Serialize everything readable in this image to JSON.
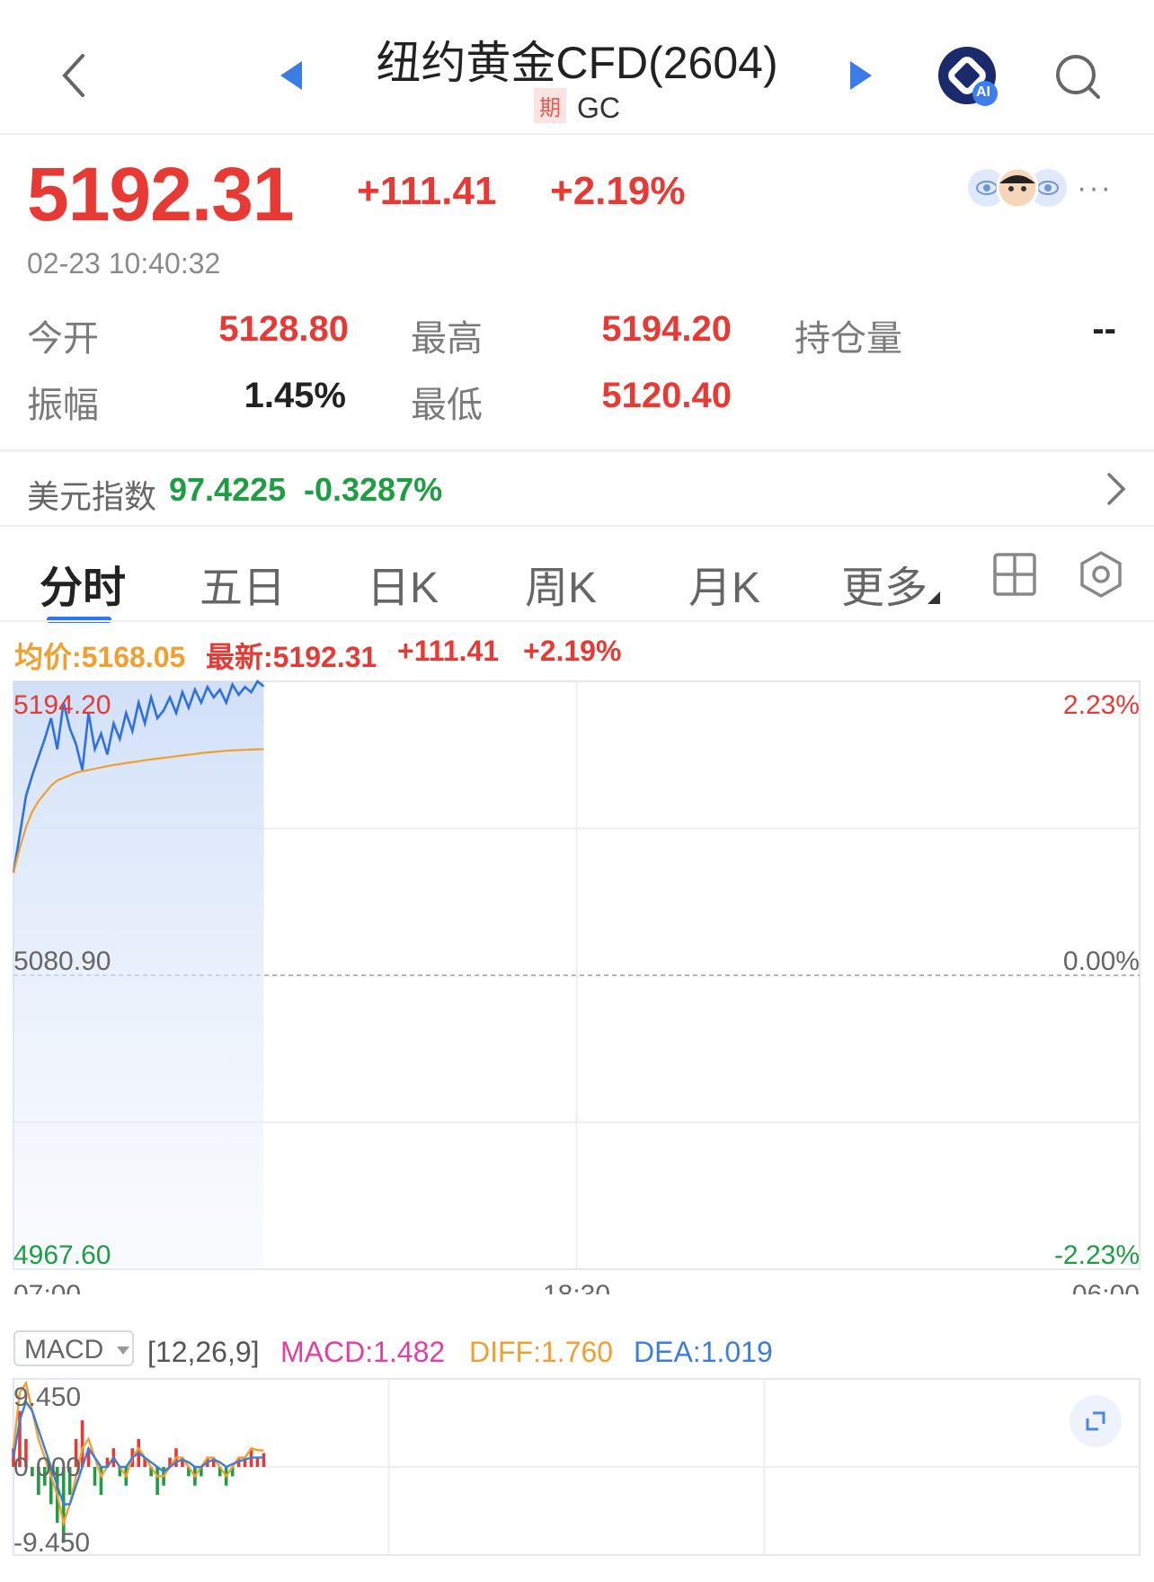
{
  "header": {
    "title": "纽约黄金CFD(2604)",
    "tag": "期",
    "code": "GC",
    "ai_badge": "AI"
  },
  "quote": {
    "price": "5192.31",
    "change": "+111.41",
    "change_pct": "+2.19%",
    "timestamp": "02-23 10:40:32",
    "more": "···",
    "stats": [
      {
        "label": "今开",
        "value": "5128.80"
      },
      {
        "label": "最高",
        "value": "5194.20"
      },
      {
        "label": "持仓量",
        "value": "--"
      },
      {
        "label": "振幅",
        "value": "1.45%"
      },
      {
        "label": "最低",
        "value": "5120.40"
      }
    ]
  },
  "related": {
    "name": "美元指数",
    "value": "97.4225",
    "change_pct": "-0.3287%"
  },
  "tabs": [
    "分时",
    "五日",
    "日K",
    "周K",
    "月K",
    "更多"
  ],
  "chart_info": {
    "avg": "均价:5168.05",
    "latest": "最新:5192.31",
    "change": "+111.41",
    "change_pct": "+2.19%"
  },
  "chart_data": [
    {
      "type": "line",
      "y_labels_left": [
        "5194.20",
        "5080.90",
        "4967.60"
      ],
      "y_labels_right": [
        "2.23%",
        "0.00%",
        "-2.23%"
      ],
      "x_labels": [
        "07:00",
        "18:30",
        "06:00"
      ],
      "ylim": [
        4967.6,
        5194.2
      ],
      "grid": true,
      "series": [
        {
          "name": "",
          "color": "#2f6fe0",
          "x": [
            0,
            2,
            4,
            6,
            8,
            10,
            12,
            14,
            16,
            18,
            20,
            22,
            24,
            26,
            28,
            30,
            32,
            34,
            36,
            38,
            40,
            42,
            44,
            46,
            48,
            50,
            52,
            54,
            56,
            58,
            60,
            62,
            64,
            66,
            68,
            70,
            72,
            74,
            76,
            78,
            80
          ],
          "values": [
            5120.4,
            5135,
            5150,
            5158,
            5165,
            5172,
            5180,
            5168,
            5186,
            5176,
            5170,
            5160,
            5182,
            5168,
            5174,
            5166,
            5178,
            5172,
            5182,
            5175,
            5186,
            5178,
            5188,
            5180,
            5183,
            5188,
            5182,
            5190,
            5184,
            5191,
            5186,
            5192,
            5188,
            5191,
            5186,
            5193,
            5189,
            5192,
            5190,
            5194.2,
            5192.31
          ]
        },
        {
          "name": "均价",
          "color": "#f0a030",
          "x": [
            0,
            2,
            4,
            6,
            8,
            10,
            12,
            14,
            16,
            18,
            20,
            22,
            24,
            26,
            28,
            30,
            32,
            34,
            36,
            38,
            40,
            42,
            44,
            46,
            48,
            50,
            52,
            54,
            56,
            58,
            60,
            62,
            64,
            66,
            68,
            70,
            72,
            74,
            76,
            78,
            80
          ],
          "values": [
            5120.4,
            5130,
            5138,
            5144,
            5148,
            5151,
            5154,
            5156,
            5157,
            5158,
            5159,
            5159.5,
            5160,
            5160.5,
            5161,
            5161.5,
            5162,
            5162.3,
            5162.7,
            5163,
            5163.4,
            5163.8,
            5164.1,
            5164.4,
            5164.7,
            5165,
            5165.3,
            5165.6,
            5165.9,
            5166.2,
            5166.5,
            5166.8,
            5167,
            5167.2,
            5167.4,
            5167.6,
            5167.7,
            5167.8,
            5167.9,
            5168,
            5168.05
          ]
        }
      ],
      "x_total": 360
    },
    {
      "type": "bar",
      "title": "MACD",
      "params": "[12,26,9]",
      "macd_label": "MACD:1.482",
      "diff_label": "DIFF:1.760",
      "dea_label": "DEA:1.019",
      "y_labels": [
        "9.450",
        "0.000",
        "-9.450"
      ],
      "ylim": [
        -9.45,
        9.45
      ],
      "x_total": 360,
      "x": [
        0,
        2,
        4,
        6,
        8,
        10,
        12,
        14,
        16,
        18,
        20,
        22,
        24,
        26,
        28,
        30,
        32,
        34,
        36,
        38,
        40,
        42,
        44,
        46,
        48,
        50,
        52,
        54,
        56,
        58,
        60,
        62,
        64,
        66,
        68,
        70,
        72,
        74,
        76,
        78,
        80
      ],
      "histogram": [
        2,
        6,
        3,
        -1,
        -3,
        -2,
        -4,
        -6,
        -8,
        -3,
        3,
        5,
        2,
        -2,
        -3,
        1,
        2,
        -1,
        -2,
        2,
        3,
        1,
        -1,
        -3,
        -2,
        1,
        2,
        1,
        -1,
        -2,
        -1,
        1,
        1,
        -1,
        -2,
        -1,
        1,
        1,
        2,
        1,
        1.482
      ],
      "diff": [
        2,
        8,
        9,
        6,
        3,
        1,
        -1,
        -3,
        -6,
        -4,
        -1,
        2,
        3,
        1,
        -1,
        0,
        1,
        0,
        -1,
        1,
        2,
        1,
        0,
        -1,
        -1,
        0,
        1,
        1,
        0,
        -1,
        0,
        1,
        1,
        0,
        -1,
        0,
        1,
        1,
        2,
        1.8,
        1.76
      ],
      "dea": [
        1,
        5,
        7,
        6,
        4,
        2,
        0,
        -2,
        -4,
        -4,
        -2,
        0,
        2,
        1,
        0,
        0,
        1,
        0,
        0,
        1,
        1.5,
        1,
        0.5,
        0,
        -0.5,
        0,
        0.5,
        0.8,
        0.5,
        0,
        0,
        0.5,
        0.8,
        0.5,
        0,
        0.3,
        0.6,
        0.8,
        1,
        1,
        1.019
      ]
    }
  ]
}
